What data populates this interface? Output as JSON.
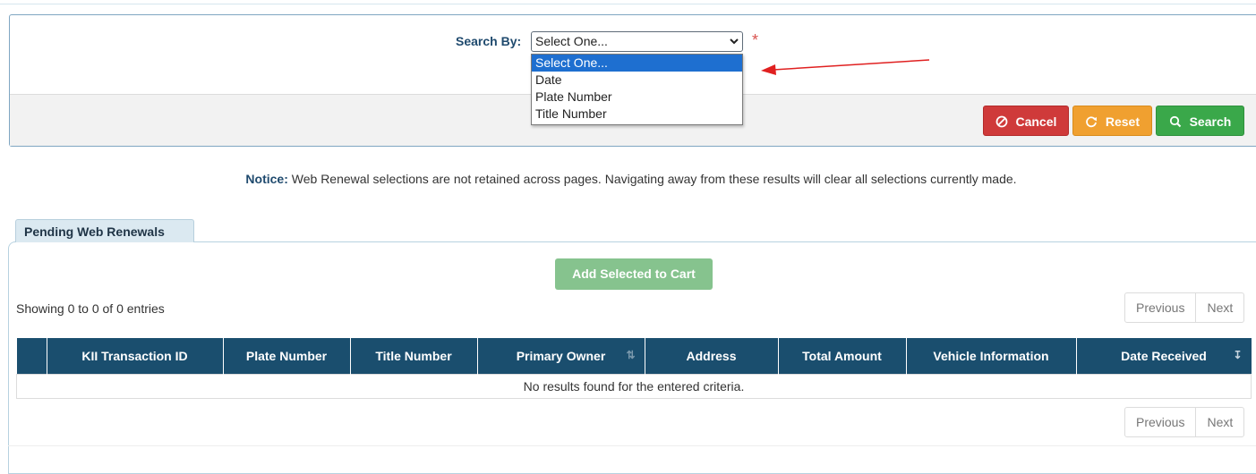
{
  "search": {
    "label": "Search By:",
    "selected": "Select One...",
    "required_mark": "*",
    "options": [
      "Select One...",
      "Date",
      "Plate Number",
      "Title Number"
    ]
  },
  "buttons": {
    "cancel": "Cancel",
    "reset": "Reset",
    "search": "Search"
  },
  "notice": {
    "label": "Notice:",
    "text": " Web Renewal selections are not retained across pages. Navigating away from these results will clear all selections currently made."
  },
  "results": {
    "tab_label": "Pending Web Renewals",
    "add_to_cart": "Add Selected to Cart",
    "showing": "Showing 0 to 0 of 0 entries",
    "pager": {
      "previous": "Previous",
      "next": "Next"
    },
    "columns": [
      "",
      "KII Transaction ID",
      "Plate Number",
      "Title Number",
      "Primary Owner",
      "Address",
      "Total Amount",
      "Vehicle Information",
      "Date Received"
    ],
    "empty_message": "No results found for the entered criteria."
  },
  "colors": {
    "header_bg": "#1a4e6e",
    "cancel": "#cf3a3a",
    "reset": "#f0a030",
    "search": "#3aa84a",
    "dropdown_selected": "#1e6fd0",
    "arrow": "#e02020"
  }
}
